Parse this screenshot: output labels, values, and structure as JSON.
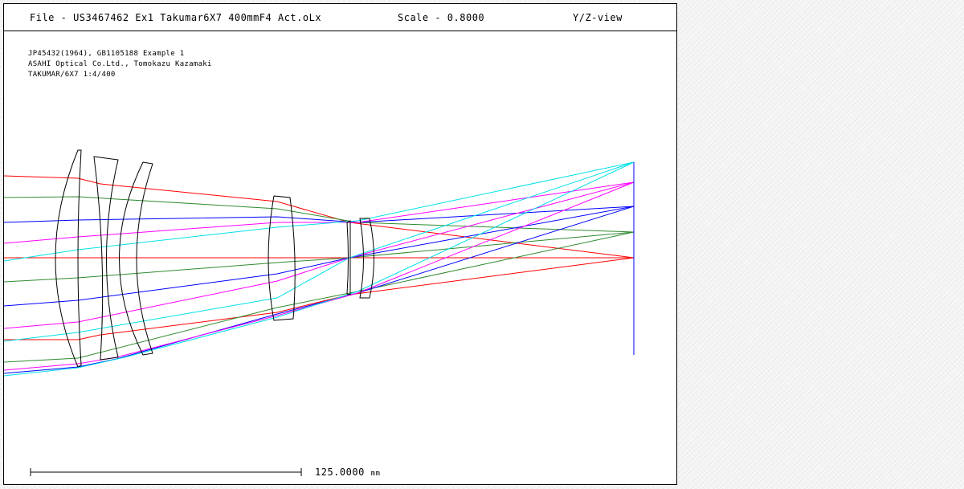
{
  "header": {
    "file_label": "File - US3467462 Ex1 Takumar6X7 400mmF4 Act.oLx",
    "scale_label": "Scale - 0.8000",
    "view_label": "Y/Z-view"
  },
  "description": {
    "line1": "JP45432(1964), GB1105188 Example 1",
    "line2": "ASAHI Optical Co.Ltd., Tomokazu Kazamaki",
    "line3": "TAKUMAR/6X7 1:4/400"
  },
  "scale_bar": {
    "value": "125.0000",
    "unit": "mm"
  },
  "ray_colors": {
    "red": "#ff0000",
    "green": "#2e8b2e",
    "blue": "#0000ff",
    "magenta": "#ff00ff",
    "cyan": "#00e0e8"
  }
}
